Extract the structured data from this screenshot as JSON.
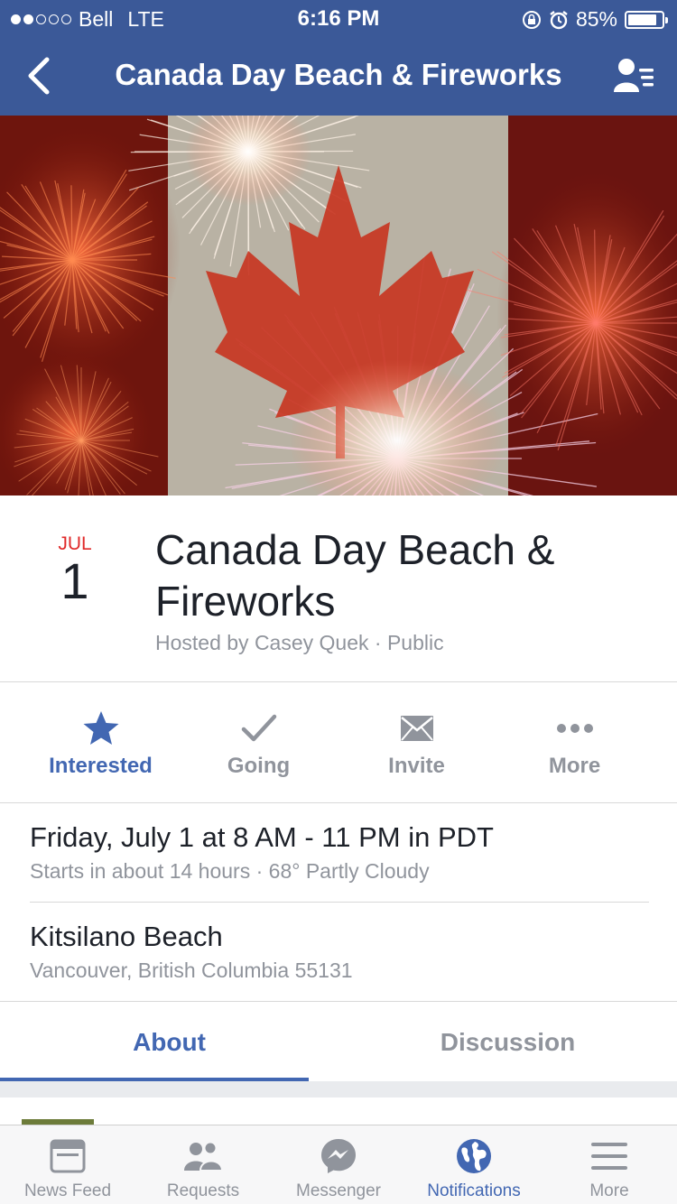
{
  "status_bar": {
    "carrier": "Bell",
    "network": "LTE",
    "time": "6:16 PM",
    "battery": "85%",
    "battery_level": 0.85,
    "signal_bars_filled": 2,
    "signal_bars_total": 5
  },
  "nav": {
    "title": "Canada Day Beach & Fireworks"
  },
  "event": {
    "month": "JUL",
    "day": "1",
    "title": "Canada Day Beach & Fireworks",
    "meta": "Hosted by Casey Quek · Public"
  },
  "actions": [
    {
      "label": "Interested",
      "icon": "star-icon",
      "active": true
    },
    {
      "label": "Going",
      "icon": "check-icon",
      "active": false
    },
    {
      "label": "Invite",
      "icon": "envelope-icon",
      "active": false
    },
    {
      "label": "More",
      "icon": "more-dots-icon",
      "active": false
    }
  ],
  "details": {
    "when": "Friday, July 1 at 8 AM - 11 PM in PDT",
    "when_sub": "Starts in about 14 hours · 68° Partly Cloudy",
    "where": "Kitsilano Beach",
    "where_sub": "Vancouver, British Columbia 55131"
  },
  "tabs": [
    {
      "label": "About",
      "active": true
    },
    {
      "label": "Discussion",
      "active": false
    }
  ],
  "tabbar": [
    {
      "label": "News Feed",
      "icon": "news-feed-icon",
      "active": false
    },
    {
      "label": "Requests",
      "icon": "friends-icon",
      "active": false
    },
    {
      "label": "Messenger",
      "icon": "messenger-icon",
      "active": false
    },
    {
      "label": "Notifications",
      "icon": "globe-icon",
      "active": true
    },
    {
      "label": "More",
      "icon": "menu-icon",
      "active": false
    }
  ],
  "colors": {
    "brand": "#3b5998",
    "accent": "#4267b2",
    "date_red": "#e02a2a",
    "muted": "#90949c"
  }
}
